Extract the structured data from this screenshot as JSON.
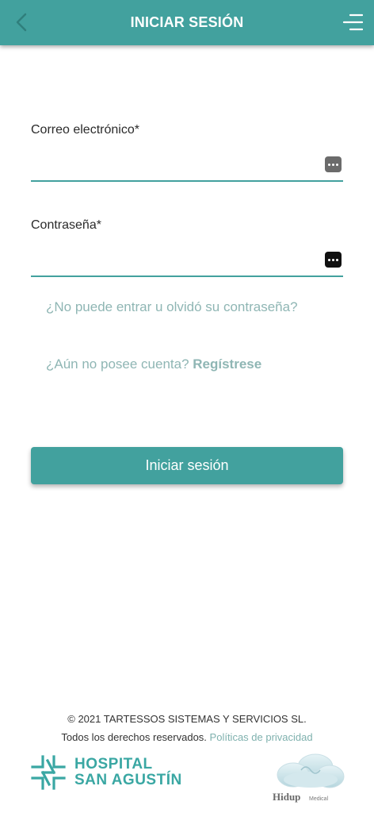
{
  "header": {
    "title": "INICIAR SESIÓN",
    "back_icon": "chevron-left-icon",
    "menu_icon": "menu-icon"
  },
  "form": {
    "email": {
      "label": "Correo electrónico*",
      "value": "",
      "placeholder": ""
    },
    "password": {
      "label": "Contraseña*",
      "value": "",
      "placeholder": ""
    },
    "forgot_link": "¿No puede entrar u olvidó su contraseña?",
    "no_account_text": "¿Aún no posee cuenta?",
    "register_link": "Regístrese",
    "submit_label": "Iniciar sesión"
  },
  "footer": {
    "copyright": "© 2021 TARTESSOS SISTEMAS Y SERVICIOS SL.",
    "rights": "Todos los derechos reservados.",
    "privacy_link": "Políticas de privacidad",
    "hospital_logo": {
      "line1": "HOSPITAL",
      "line2": "SAN AGUSTÍN"
    },
    "hidup_logo": {
      "name": "Hidup",
      "sub": "Medical"
    }
  },
  "colors": {
    "primary": "#42a19e",
    "link": "#8fb6b4",
    "hospital": "#3aa7a3"
  }
}
